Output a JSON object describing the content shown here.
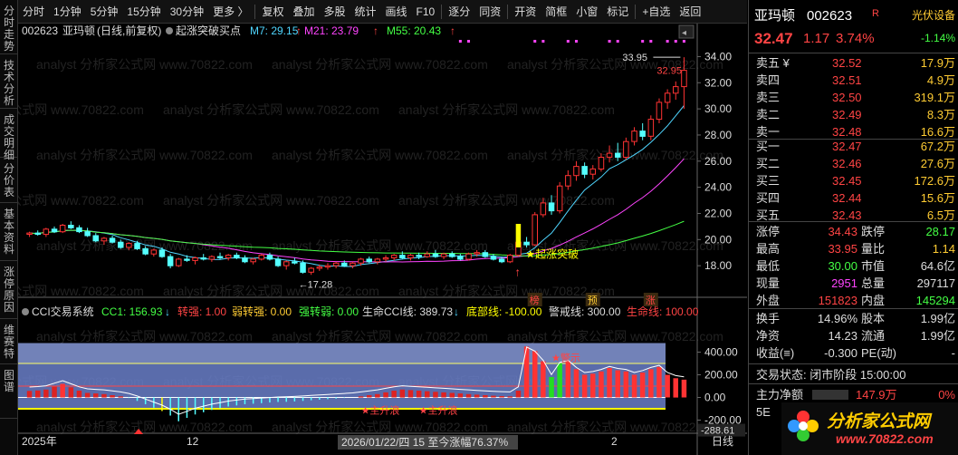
{
  "toolbar": {
    "items": [
      "分时",
      "1分钟",
      "5分钟",
      "15分钟",
      "30分钟",
      "更多",
      "复权",
      "叠加",
      "多股",
      "统计",
      "画线",
      "F10",
      "逐分",
      "同资",
      "开资",
      "简框",
      "小窗",
      "标记",
      "+自选",
      "返回"
    ]
  },
  "left_tabs": [
    "分时走势",
    "技术分析",
    "成交明细",
    "分价表",
    "基本资料",
    "涨停原因",
    "维赛特",
    "图谱"
  ],
  "main_chart": {
    "code": "002623",
    "name": "亚玛顿",
    "mode": "(日线,前复权)",
    "indicator": "起涨突破买点",
    "ma7_label": "M7: 29.15",
    "ma21_label": "M21: 23.79",
    "ma55_label": "M55: 20.43",
    "high_label": "33.95",
    "close_label": "32.95",
    "low_label": "17.28",
    "breakout_label": "★起涨突破",
    "badges": [
      "榜",
      "预",
      "涨"
    ],
    "y_ticks": [
      "34.00",
      "32.00",
      "30.00",
      "28.00",
      "26.00",
      "24.00",
      "22.00",
      "20.00",
      "18.00"
    ]
  },
  "cci": {
    "title": "CCI交易系统",
    "cc1": "CC1: 156.93",
    "zhuanqiang": "转强: 1.00",
    "ruozhuanqiang": "弱转强: 0.00",
    "qiangzhuanruo": "强转弱: 0.00",
    "shengming": "生命CCI线: 389.73",
    "dibu": "底部线: -100.00",
    "jingjie": "警戒线: 300.00",
    "shengmingxian": "生命线: 100.00",
    "y_ticks": [
      "400.00",
      "200.00",
      "0.00",
      "-200.00"
    ],
    "min_label": "-288.61",
    "rise_label1": "★主升浪",
    "rise_label2": "★主升浪",
    "top_label": "★警示"
  },
  "x_axis": {
    "start": "2025年",
    "mid": "12",
    "cursor": "2026/01/22/四 15 至今涨幅76.37%",
    "end_tick": "2",
    "period": "日线"
  },
  "watermark": "analyst 分析家公式网 www.70822.com",
  "quote": {
    "name": "亚玛顿",
    "code": "002623",
    "flag": "R",
    "tag": "光伏设备",
    "price": "32.47",
    "change": "1.17",
    "pct": "3.74%",
    "sector_pct": "-1.14%",
    "asks": [
      {
        "label": "卖五 ¥",
        "price": "32.52",
        "vol": "17.9万"
      },
      {
        "label": "卖四",
        "price": "32.51",
        "vol": "4.9万"
      },
      {
        "label": "卖三",
        "price": "32.50",
        "vol": "319.1万"
      },
      {
        "label": "卖二",
        "price": "32.49",
        "vol": "8.3万"
      },
      {
        "label": "卖一",
        "price": "32.48",
        "vol": "16.6万"
      }
    ],
    "bids": [
      {
        "label": "买一",
        "price": "32.47",
        "vol": "67.2万"
      },
      {
        "label": "买二",
        "price": "32.46",
        "vol": "27.6万"
      },
      {
        "label": "买三",
        "price": "32.45",
        "vol": "172.6万"
      },
      {
        "label": "买四",
        "price": "32.44",
        "vol": "15.6万"
      },
      {
        "label": "买五",
        "price": "32.43",
        "vol": "6.5万"
      }
    ],
    "stats": [
      {
        "l1": "涨停",
        "v1": "34.43",
        "l2": "跌停",
        "v2": "28.17"
      },
      {
        "l1": "最高",
        "v1": "33.95",
        "l2": "量比",
        "v2": "1.14"
      },
      {
        "l1": "最低",
        "v1": "30.00",
        "l2": "市值",
        "v2": "64.6亿"
      },
      {
        "l1": "现量",
        "v1": "2951",
        "l2": "总量",
        "v2": "297117"
      },
      {
        "l1": "外盘",
        "v1": "151823",
        "l2": "内盘",
        "v2": "145294"
      }
    ],
    "stats2": [
      {
        "l1": "换手",
        "v1": "14.96%",
        "l2": "股本",
        "v2": "1.99亿"
      },
      {
        "l1": "净资",
        "v1": "14.23",
        "l2": "流通",
        "v2": "1.99亿"
      },
      {
        "l1": "收益(≡)",
        "v1": "-0.300",
        "l2": "PE(动)",
        "v2": "-"
      }
    ],
    "status": "交易状态: 闭市阶段 15:00:00",
    "netflow_label": "主力净额",
    "netflow_val": "147.9万",
    "netflow_pct": "0%",
    "brand": "分析家公式网",
    "brand_url": "www.70822.com"
  },
  "chart_data": {
    "type": "candlestick",
    "candles": [
      [
        20.4,
        20.6,
        20.2,
        20.5
      ],
      [
        20.5,
        20.7,
        20.3,
        20.4
      ],
      [
        20.4,
        20.9,
        20.2,
        20.8
      ],
      [
        20.8,
        21.0,
        20.5,
        20.6
      ],
      [
        20.6,
        21.2,
        20.5,
        21.1
      ],
      [
        21.1,
        21.4,
        20.8,
        20.9
      ],
      [
        20.9,
        21.1,
        20.5,
        20.6
      ],
      [
        20.6,
        20.9,
        20.2,
        20.3
      ],
      [
        20.3,
        20.5,
        19.8,
        19.9
      ],
      [
        19.9,
        20.2,
        19.6,
        20.1
      ],
      [
        20.1,
        20.3,
        19.7,
        19.8
      ],
      [
        19.8,
        20.0,
        19.3,
        19.4
      ],
      [
        19.4,
        19.8,
        19.2,
        19.7
      ],
      [
        19.7,
        19.9,
        19.2,
        19.3
      ],
      [
        19.3,
        19.5,
        18.8,
        18.9
      ],
      [
        18.9,
        19.3,
        18.7,
        19.2
      ],
      [
        19.2,
        19.4,
        18.6,
        18.7
      ],
      [
        18.7,
        18.9,
        17.8,
        18.0
      ],
      [
        18.0,
        18.6,
        17.9,
        18.5
      ],
      [
        18.5,
        18.8,
        18.3,
        18.4
      ],
      [
        18.4,
        18.7,
        18.1,
        18.6
      ],
      [
        18.6,
        18.9,
        18.4,
        18.5
      ],
      [
        18.5,
        18.8,
        18.3,
        18.7
      ],
      [
        18.7,
        19.0,
        18.5,
        18.6
      ],
      [
        18.6,
        18.9,
        18.4,
        18.8
      ],
      [
        18.8,
        19.0,
        18.5,
        18.6
      ],
      [
        18.6,
        18.8,
        18.2,
        18.3
      ],
      [
        18.3,
        18.6,
        18.1,
        18.5
      ],
      [
        18.5,
        18.9,
        18.4,
        18.8
      ],
      [
        18.8,
        19.0,
        18.4,
        18.5
      ],
      [
        18.5,
        18.7,
        17.9,
        18.0
      ],
      [
        18.0,
        18.4,
        17.7,
        18.3
      ],
      [
        18.3,
        18.6,
        18.1,
        18.2
      ],
      [
        18.2,
        18.4,
        17.4,
        17.5
      ],
      [
        17.5,
        17.9,
        17.3,
        17.8
      ],
      [
        17.8,
        18.1,
        17.6,
        17.9
      ],
      [
        17.9,
        18.2,
        17.7,
        18.0
      ],
      [
        18.0,
        18.3,
        17.8,
        18.2
      ],
      [
        18.2,
        18.4,
        17.9,
        18.0
      ],
      [
        18.0,
        18.3,
        17.8,
        18.2
      ],
      [
        18.2,
        18.6,
        18.0,
        18.5
      ],
      [
        18.5,
        18.7,
        18.2,
        18.3
      ],
      [
        18.3,
        18.6,
        18.1,
        18.5
      ],
      [
        18.5,
        18.8,
        18.3,
        18.6
      ],
      [
        18.6,
        18.9,
        18.4,
        18.8
      ],
      [
        18.8,
        19.1,
        18.5,
        18.6
      ],
      [
        18.6,
        18.9,
        18.4,
        18.8
      ],
      [
        18.8,
        19.0,
        18.5,
        18.7
      ],
      [
        18.7,
        19.1,
        18.6,
        18.9
      ],
      [
        18.9,
        19.2,
        18.6,
        18.7
      ],
      [
        18.7,
        19.0,
        18.5,
        18.9
      ],
      [
        18.9,
        19.1,
        18.6,
        18.7
      ],
      [
        18.7,
        18.9,
        18.4,
        18.5
      ],
      [
        18.5,
        19.0,
        18.4,
        18.9
      ],
      [
        18.9,
        19.2,
        18.7,
        19.0
      ],
      [
        19.0,
        19.2,
        18.6,
        18.7
      ],
      [
        18.7,
        18.9,
        18.4,
        18.5
      ],
      [
        18.5,
        18.7,
        18.2,
        18.3
      ],
      [
        18.3,
        18.9,
        18.2,
        18.8
      ],
      [
        18.8,
        19.9,
        18.7,
        19.8
      ],
      [
        19.8,
        20.2,
        19.4,
        19.6
      ],
      [
        19.6,
        22.1,
        19.5,
        21.9
      ],
      [
        21.9,
        23.2,
        21.7,
        22.8
      ],
      [
        22.8,
        23.4,
        21.9,
        22.2
      ],
      [
        22.2,
        24.4,
        22.0,
        24.1
      ],
      [
        24.1,
        25.3,
        23.8,
        24.9
      ],
      [
        24.9,
        26.0,
        24.5,
        25.6
      ],
      [
        25.6,
        25.9,
        24.7,
        25.0
      ],
      [
        25.0,
        25.7,
        24.6,
        25.4
      ],
      [
        25.4,
        26.6,
        25.2,
        26.3
      ],
      [
        26.3,
        27.2,
        25.9,
        26.6
      ],
      [
        26.6,
        27.4,
        26.0,
        26.3
      ],
      [
        26.3,
        27.8,
        26.1,
        27.5
      ],
      [
        27.5,
        28.6,
        27.2,
        28.3
      ],
      [
        28.3,
        28.9,
        27.6,
        27.9
      ],
      [
        27.9,
        29.5,
        27.6,
        29.2
      ],
      [
        29.2,
        30.8,
        28.9,
        30.5
      ],
      [
        30.5,
        31.5,
        30.0,
        31.2
      ],
      [
        31.2,
        32.1,
        30.7,
        31.7
      ],
      [
        31.7,
        33.95,
        30.0,
        32.95
      ]
    ],
    "cci_values": [
      58,
      62,
      70,
      95,
      120,
      90,
      60,
      40,
      35,
      30,
      20,
      10,
      -5,
      -30,
      -60,
      -90,
      -120,
      -160,
      -210,
      -180,
      -150,
      -130,
      -110,
      -95,
      -80,
      -70,
      -60,
      -55,
      -50,
      -45,
      -40,
      -38,
      -35,
      -30,
      -25,
      -20,
      -15,
      -10,
      -5,
      0,
      10,
      20,
      30,
      45,
      60,
      70,
      65,
      60,
      55,
      50,
      45,
      40,
      35,
      30,
      25,
      20,
      15,
      12,
      10,
      60,
      450,
      410,
      320,
      180,
      300,
      320,
      250,
      200,
      210,
      230,
      260,
      240,
      230,
      200,
      220,
      250,
      270,
      200,
      170,
      156.93
    ],
    "ylim": [
      16,
      35
    ],
    "cci_ylim": [
      -300,
      500
    ]
  }
}
